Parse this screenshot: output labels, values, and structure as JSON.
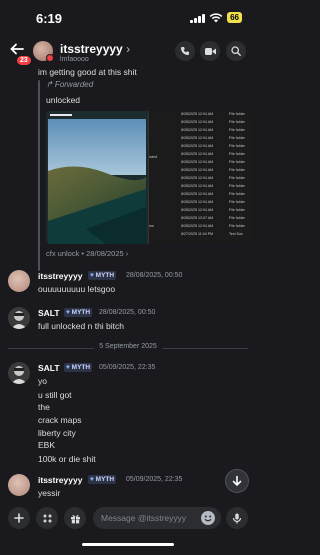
{
  "status": {
    "time": "6:19",
    "battery": "66"
  },
  "header": {
    "name": "itsstreyyyy",
    "chevron": "›",
    "subtitle": "lmfaoooo",
    "unread_badge": "23"
  },
  "messages": {
    "top_line": "im getting good at this shit",
    "forwarded": {
      "label": "↱ Forwarded",
      "text": "unlocked",
      "footer": "cfx unlock • 28/08/2025 ›",
      "explorer_rows": [
        [
          "8/28/2025 12:04 AM",
          "File folder"
        ],
        [
          "8/28/2025 12:04 AM",
          "File folder"
        ],
        [
          "8/28/2025 12:04 AM",
          "File folder"
        ],
        [
          "8/28/2025 12:04 AM",
          "File folder"
        ],
        [
          "8/28/2025 12:04 AM",
          "File folder"
        ],
        [
          "8/28/2025 12:04 AM",
          "File folder"
        ],
        [
          "8/28/2025 12:04 AM",
          "File folder"
        ],
        [
          "8/28/2025 12:04 AM",
          "File folder"
        ],
        [
          "8/28/2025 12:04 AM",
          "File folder"
        ],
        [
          "8/28/2025 12:04 AM",
          "File folder"
        ],
        [
          "8/28/2025 12:04 AM",
          "File folder"
        ],
        [
          "8/28/2025 12:04 AM",
          "File folder"
        ],
        [
          "8/28/2025 12:04 AM",
          "File folder"
        ],
        [
          "8/28/2025 12:07 AM",
          "File folder"
        ],
        [
          "8/28/2025 12:04 AM",
          "File folder"
        ],
        [
          "8/27/2025 11:04 PM",
          "Text Doc"
        ]
      ],
      "explorer_side_labels": [
        "nded",
        "ms"
      ]
    },
    "msg1": {
      "author": "itsstreyyyy",
      "tag": "MYTH",
      "time": "28/08/2025, 00:50",
      "lines": [
        "ouuuuuuuuu letsgoo"
      ]
    },
    "msg2": {
      "author": "SALT",
      "tag": "MYTH",
      "time": "28/08/2025, 00:50",
      "lines": [
        "full unlocked n thi bitch"
      ]
    },
    "date_divider": "5 September 2025",
    "msg3": {
      "author": "SALT",
      "tag": "MYTH",
      "time": "05/09/2025, 22:35",
      "lines": [
        "yo",
        "u still got",
        "the",
        "crack maps",
        "liberty city",
        "EBK",
        "100k or die shit"
      ]
    },
    "msg4": {
      "author": "itsstreyyyy",
      "tag": "MYTH",
      "time": "05/09/2025, 22:35",
      "lines": [
        "yessir"
      ]
    }
  },
  "compose": {
    "placeholder": "Message @itsstreyyyy"
  },
  "colors": {
    "background": "#1a1a1e",
    "mention_red": "#f23f43",
    "dnd_red": "#f23f43"
  },
  "icons": [
    "back-arrow-icon",
    "call-icon",
    "video-icon",
    "search-icon",
    "plus-icon",
    "apps-icon",
    "gift-icon",
    "emoji-icon",
    "mic-icon",
    "chevron-down-icon",
    "heart-icon",
    "forward-icon"
  ]
}
